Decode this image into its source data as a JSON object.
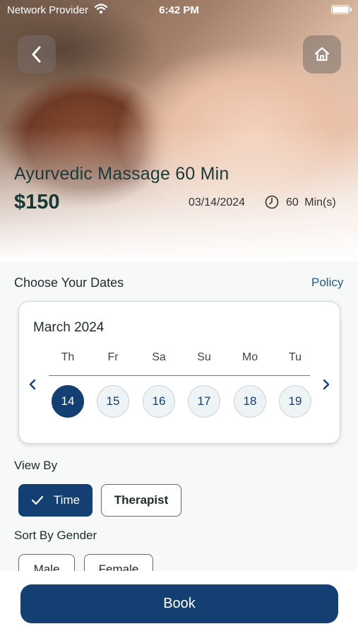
{
  "status_bar": {
    "carrier": "Network Provider",
    "time": "6:42 PM"
  },
  "service": {
    "title": "Ayurvedic Massage 60 Min",
    "price": "$150",
    "date": "03/14/2024",
    "duration": "60 Min(s)"
  },
  "dates_section": {
    "label": "Choose Your Dates",
    "policy_link": "Policy"
  },
  "calendar": {
    "month": "March 2024",
    "days": [
      {
        "dow": "Th",
        "num": "14",
        "selected": true
      },
      {
        "dow": "Fr",
        "num": "15",
        "selected": false
      },
      {
        "dow": "Sa",
        "num": "16",
        "selected": false
      },
      {
        "dow": "Su",
        "num": "17",
        "selected": false
      },
      {
        "dow": "Mo",
        "num": "18",
        "selected": false
      },
      {
        "dow": "Tu",
        "num": "19",
        "selected": false
      }
    ]
  },
  "view_by": {
    "label": "View By",
    "options": [
      "Time",
      "Therapist"
    ],
    "selected": "Time"
  },
  "sort_by_gender": {
    "label": "Sort By Gender",
    "options": [
      "Male",
      "Female"
    ]
  },
  "book_button": "Book",
  "icons": {
    "back": "chevron-left-icon",
    "home": "home-icon",
    "clock": "clock-icon",
    "check": "checkmark-icon",
    "prev": "chevron-left-icon",
    "next": "chevron-right-icon"
  },
  "colors": {
    "primary": "#133f73",
    "link": "#225a86",
    "title": "#1c3a38"
  }
}
